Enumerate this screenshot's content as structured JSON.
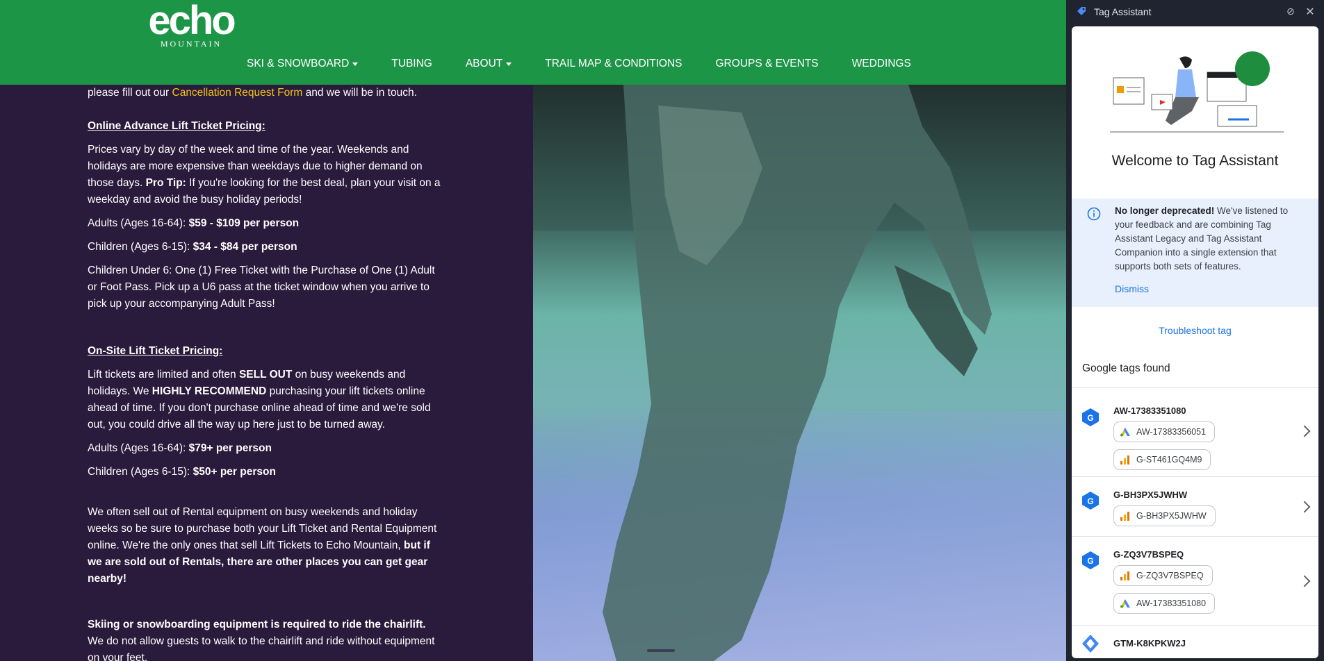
{
  "site": {
    "logo_word": "echo",
    "logo_sub": "MOUNTAIN",
    "nav": [
      {
        "label": "SKI & SNOWBOARD",
        "dropdown": true
      },
      {
        "label": "TUBING",
        "dropdown": false
      },
      {
        "label": "ABOUT",
        "dropdown": true
      },
      {
        "label": "TRAIL MAP & CONDITIONS",
        "dropdown": false
      },
      {
        "label": "GROUPS & EVENTS",
        "dropdown": false
      },
      {
        "label": "WEDDINGS",
        "dropdown": false
      }
    ],
    "colors": {
      "header": "#1d9547",
      "content_bg": "#2a1a3c",
      "link": "#f4c518"
    }
  },
  "content": {
    "cancel_prefix": "please fill out our ",
    "cancel_link": "Cancellation Request Form",
    "cancel_suffix": " and we will be in touch.",
    "online_heading": "Online Advance Lift Ticket Pricing:",
    "online_p1a": "Prices vary by day of the week and time of the year. Weekends and holidays are more expensive than weekdays due to higher demand on those days. ",
    "online_p1_bold": "Pro Tip:",
    "online_p1b": " If you're looking for the best deal, plan your visit on a weekday and avoid the busy holiday periods!",
    "online_adults_label": "Adults (Ages 16-64): ",
    "online_adults_price": "$59 - $109 per person",
    "online_children_label": "Children (Ages 6-15): ",
    "online_children_price": "$34 - $84 per person",
    "online_under6": "Children Under 6: One (1) Free Ticket with the Purchase of One (1) Adult or Foot Pass. Pick up a U6 pass at the ticket window when you arrive to pick up your accompanying Adult Pass!",
    "onsite_heading": "On-Site Lift Ticket Pricing:",
    "onsite_p1a": "Lift tickets are limited and often ",
    "onsite_p1_bold1": "SELL OUT",
    "onsite_p1b": " on busy weekends and holidays. We ",
    "onsite_p1_bold2": "HIGHLY RECOMMEND",
    "onsite_p1c": " purchasing your lift tickets online ahead of time. If you don't purchase online ahead of time and we're sold out, you could drive all the way up here just to be turned away.",
    "onsite_adults_label": "Adults (Ages 16-64): ",
    "onsite_adults_price": "$79+ per person",
    "onsite_children_label": "Children (Ages 6-15): ",
    "onsite_children_price": "$50+ per person",
    "rental_a": "We often sell out of Rental equipment on busy weekends and holiday weeks so be sure to purchase both your Lift Ticket and Rental Equipment online. We're the only ones that sell Lift Tickets to Echo Mountain, ",
    "rental_bold": "but if we are sold out of Rentals, there are other places you can get gear nearby!",
    "equip_bold": "Skiing or snowboarding equipment is required to ride the chairlift.",
    "equip_text": "We do not allow guests to walk to the chairlift and ride without equipment on your feet."
  },
  "tag_assistant": {
    "title": "Tag Assistant",
    "welcome": "Welcome to Tag Assistant",
    "banner_bold": "No longer deprecated!",
    "banner_text": " We've listened to your feedback and are combining Tag Assistant Legacy and Tag Assistant Companion into a single extension that supports both sets of features.",
    "dismiss": "Dismiss",
    "troubleshoot": "Troubleshoot tag",
    "found_heading": "Google tags found",
    "groups": [
      {
        "id": "AW-17383351080",
        "chips": [
          {
            "type": "ads",
            "label": "AW-17383356051"
          },
          {
            "type": "analytics",
            "label": "G-ST461GQ4M9"
          }
        ]
      },
      {
        "id": "G-BH3PX5JWHW",
        "chips": [
          {
            "type": "analytics",
            "label": "G-BH3PX5JWHW"
          }
        ]
      },
      {
        "id": "G-ZQ3V7BSPEQ",
        "chips": [
          {
            "type": "analytics",
            "label": "G-ZQ3V7BSPEQ"
          },
          {
            "type": "ads",
            "label": "AW-17383351080"
          }
        ]
      },
      {
        "id": "GTM-K8KPKW2J",
        "chips": []
      }
    ],
    "colors": {
      "accent": "#1a73e8",
      "banner": "#e8f0fe"
    }
  }
}
